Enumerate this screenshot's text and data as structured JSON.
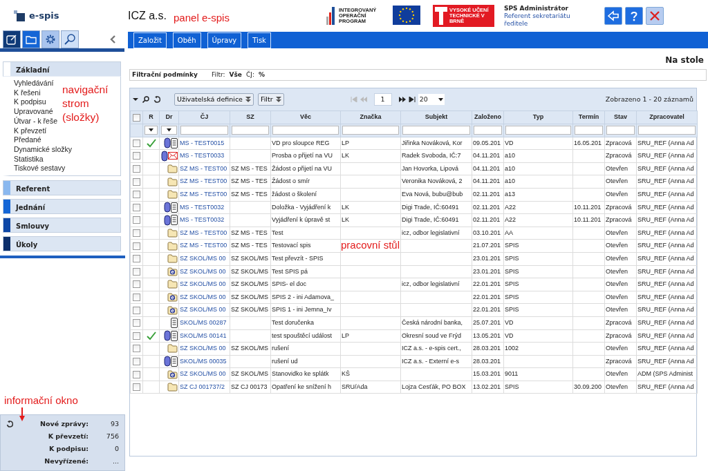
{
  "header": {
    "logo_text": "e-spis",
    "organization": "ICZ a.s.",
    "annotation": "panel e-spis",
    "partner_logos": [
      {
        "kind": "iop",
        "text": "INTEGROVANÝ OPERAČNÍ PROGRAM"
      },
      {
        "kind": "eu"
      },
      {
        "kind": "vut",
        "text": "VYSOKÉ UČENÍ TECHNICKÉ V BRNĚ"
      }
    ],
    "user_name": "SPS Administrátor",
    "user_role": "Referent sekretariátu ředitele",
    "buttons": [
      {
        "kind": "back"
      },
      {
        "kind": "help"
      },
      {
        "kind": "close"
      }
    ]
  },
  "sidebar": {
    "tabs": [
      {
        "kind": "note"
      },
      {
        "kind": "folder"
      },
      {
        "kind": "gear"
      },
      {
        "kind": "search"
      }
    ],
    "annotation": "navigační strom (složky)",
    "groups": [
      {
        "label": "Základní",
        "color": "#ffffff",
        "expanded": true,
        "items": [
          "Vyhledávání",
          "K řešeni",
          "K podpisu",
          "Upravované",
          "Útvar - k řeše",
          "K převzetí",
          "Předané",
          "Dynamické složky",
          "Statistika",
          "Tiskové sestavy"
        ]
      },
      {
        "label": "Referent",
        "color": "#8ab8ef",
        "expanded": false
      },
      {
        "label": "Jednání",
        "color": "#1566d6",
        "expanded": false
      },
      {
        "label": "Smlouvy",
        "color": "#0e47a6",
        "expanded": false
      },
      {
        "label": "Úkoly",
        "color": "#0c2f6b",
        "expanded": false
      }
    ]
  },
  "info": {
    "annotation": "informační okno",
    "rows": [
      {
        "label": "Nové zprávy:",
        "value": "93"
      },
      {
        "label": "K převzetí:",
        "value": "756"
      },
      {
        "label": "K podpisu:",
        "value": "0"
      },
      {
        "label": "Nevyřízené:",
        "value": "..."
      }
    ]
  },
  "toolbar": [
    "Založit",
    "Oběh",
    "Úpravy",
    "Tisk"
  ],
  "page_title": "Na stole",
  "filter": {
    "title": "Filtrační podmínky",
    "filter_label": "Filtr:",
    "filter_value": "Vše",
    "cj_label": "ČJ:",
    "cj_value": "%"
  },
  "grid": {
    "definition_button": "Uživatelská definice",
    "filter_button": "Filtr",
    "page": "1",
    "page_size": "20",
    "summary": "Zobrazeno 1 - 20 záznamů",
    "annotation": "pracovní stůl",
    "all_checked": false,
    "marker_columns": [
      "R",
      "Dr"
    ],
    "columns": [
      "ČJ",
      "SZ",
      "Věc",
      "Značka",
      "Subjekt",
      "Založeno",
      "Typ",
      "Termín",
      "Stav",
      "Zpracovatel"
    ],
    "filter_row": [
      {
        "kind": "select"
      },
      {
        "kind": "select"
      },
      {
        "kind": "text"
      },
      {
        "kind": "text"
      },
      {
        "kind": "text"
      },
      {
        "kind": "text"
      },
      {
        "kind": "text"
      },
      {
        "kind": "text"
      },
      {
        "kind": "text"
      },
      {
        "kind": "text"
      },
      {
        "kind": "text"
      },
      {
        "kind": "text"
      }
    ],
    "rows": [
      {
        "checked": false,
        "resolved": true,
        "kind": "clip-doc",
        "cells": [
          "MS - TEST0015",
          "",
          "VD pro sloupce REG",
          "LP",
          "Jiřinka Nováková, Kor",
          "09.05.201",
          "VD",
          "16.05.201",
          "Zpracová",
          "SRU_REF (Anna Ad"
        ]
      },
      {
        "checked": false,
        "resolved": false,
        "kind": "clip-mail",
        "cells": [
          "MS - TEST0033",
          "",
          "Prosba o přijetí na VU",
          "LK",
          "Radek Svoboda, IČ:7",
          "04.11.201",
          "a10",
          "",
          "Zpracová",
          "SRU_REF (Anna Ad"
        ]
      },
      {
        "checked": false,
        "resolved": false,
        "kind": "folder",
        "cells": [
          "SZ MS - TEST00",
          "SZ MS - TES",
          "Žádost o přijetí na VU",
          "",
          "Jan Hovorka, Lipová",
          "04.11.201",
          "a10",
          "",
          "Otevřen",
          "SRU_REF (Anna Ad"
        ]
      },
      {
        "checked": false,
        "resolved": false,
        "kind": "folder",
        "cells": [
          "SZ MS - TEST00",
          "SZ MS - TES",
          "Žádost o smír",
          "",
          "Veronika Nováková, 2",
          "04.11.201",
          "a10",
          "",
          "Otevřen",
          "SRU_REF (Anna Ad"
        ]
      },
      {
        "checked": false,
        "resolved": false,
        "kind": "folder",
        "cells": [
          "SZ MS - TEST00",
          "SZ MS - TES",
          "žádost o školení",
          "",
          "Eva Nová, bubu@bub",
          "02.11.201",
          "a13",
          "",
          "Otevřen",
          "SRU_REF (Anna Ad"
        ]
      },
      {
        "checked": false,
        "resolved": false,
        "kind": "clip-doc",
        "cells": [
          "MS - TEST0032",
          "",
          "Doložka - Vyjádření k",
          "LK",
          "Digi Trade, IČ:60491",
          "02.11.201",
          "A22",
          "10.11.201",
          "Zpracová",
          "SRU_REF (Anna Ad"
        ]
      },
      {
        "checked": false,
        "resolved": false,
        "kind": "clip-doc",
        "cells": [
          "MS - TEST0032",
          "",
          "Vyjádření k úpravě st",
          "LK",
          "Digi Trade, IČ:60491",
          "02.11.201",
          "A22",
          "10.11.201",
          "Zpracová",
          "SRU_REF (Anna Ad"
        ]
      },
      {
        "checked": false,
        "resolved": false,
        "kind": "folder",
        "cells": [
          "SZ MS - TEST00",
          "SZ MS - TES",
          "Test",
          "",
          "icz, odbor legislativní",
          "03.10.201",
          "AA",
          "",
          "Otevřen",
          "SRU_REF (Anna Ad"
        ]
      },
      {
        "checked": false,
        "resolved": false,
        "kind": "folder",
        "cells": [
          "SZ MS - TEST00",
          "SZ MS - TES",
          "Testovací spis",
          "",
          "",
          "21.07.201",
          "SPIS",
          "",
          "Otevřen",
          "SRU_REF (Anna Ad"
        ]
      },
      {
        "checked": false,
        "resolved": false,
        "kind": "folder",
        "cells": [
          "SZ SKOL/MS 00",
          "SZ SKOL/MS",
          "Test převzít - SPIS",
          "",
          "",
          "23.01.201",
          "SPIS",
          "",
          "Otevřen",
          "SRU_REF (Anna Ad"
        ]
      },
      {
        "checked": false,
        "resolved": false,
        "kind": "e-folder",
        "cells": [
          "SZ SKOL/MS 00",
          "SZ SKOL/MS",
          "Test SPIS pá",
          "",
          "",
          "23.01.201",
          "SPIS",
          "",
          "Otevřen",
          "SRU_REF (Anna Ad"
        ]
      },
      {
        "checked": false,
        "resolved": false,
        "kind": "folder",
        "cells": [
          "SZ SKOL/MS 00",
          "SZ SKOL/MS",
          "SPIS- el doc",
          "",
          "icz, odbor legislativní",
          "22.01.201",
          "SPIS",
          "",
          "Otevřen",
          "SRU_REF (Anna Ad"
        ]
      },
      {
        "checked": false,
        "resolved": false,
        "kind": "e-folder",
        "cells": [
          "SZ SKOL/MS 00",
          "SZ SKOL/MS",
          "SPIS 2 - ini Adamova_",
          "",
          "",
          "22.01.201",
          "SPIS",
          "",
          "Otevřen",
          "SRU_REF (Anna Ad"
        ]
      },
      {
        "checked": false,
        "resolved": false,
        "kind": "e-folder",
        "cells": [
          "SZ SKOL/MS 00",
          "SZ SKOL/MS",
          "SPIS 1 - ini Jemna_Iv",
          "",
          "",
          "22.01.201",
          "SPIS",
          "",
          "Otevřen",
          "SRU_REF (Anna Ad"
        ]
      },
      {
        "checked": false,
        "resolved": false,
        "kind": "doc",
        "cells": [
          "SKOL/MS 00287",
          "",
          "Test doručenka",
          "",
          "Česká národní banka,",
          "25.07.201",
          "VD",
          "",
          "Zpracová",
          "SRU_REF (Anna Ad"
        ]
      },
      {
        "checked": false,
        "resolved": true,
        "kind": "clip-doc",
        "cells": [
          "SKOL/MS 00141",
          "",
          "test spouštěcí událost",
          "LP",
          "Okresní soud ve Frýd",
          "13.05.201",
          "VD",
          "",
          "Zpracová",
          "SRU_REF (Anna Ad"
        ]
      },
      {
        "checked": false,
        "resolved": false,
        "kind": "folder",
        "cells": [
          "SZ SKOL/MS 00",
          "SZ SKOL/MS",
          "rušení",
          "",
          "ICZ a.s. - e-spis cert.,",
          "28.03.201",
          "1002",
          "",
          "Otevřen",
          "SRU_REF (Anna Ad"
        ]
      },
      {
        "checked": false,
        "resolved": false,
        "kind": "clip-doc",
        "cells": [
          "SKOL/MS 00035",
          "",
          "rušení ud",
          "",
          "ICZ a.s. - Externí e-s",
          "28.03.201",
          "",
          "",
          "Zpracová",
          "SRU_REF (Anna Ad"
        ]
      },
      {
        "checked": false,
        "resolved": false,
        "kind": "e-folder",
        "cells": [
          "SZ SKOL/MS 00",
          "SZ SKOL/MS",
          "Stanovidko ke splátk",
          "KŠ",
          "",
          "15.03.201",
          "9011",
          "",
          "Otevřen",
          "ADM (SPS Administ"
        ]
      },
      {
        "checked": false,
        "resolved": false,
        "kind": "folder",
        "cells": [
          "SZ CJ 001737/2",
          "SZ CJ 00173",
          "Opatření ke snížení h",
          "SRU/Ada",
          "Lojza Cesťák, PO BOX",
          "13.02.201",
          "SPIS",
          "30.09.200",
          "Otevřen",
          "SRU_REF (Anna Ad"
        ]
      }
    ]
  }
}
